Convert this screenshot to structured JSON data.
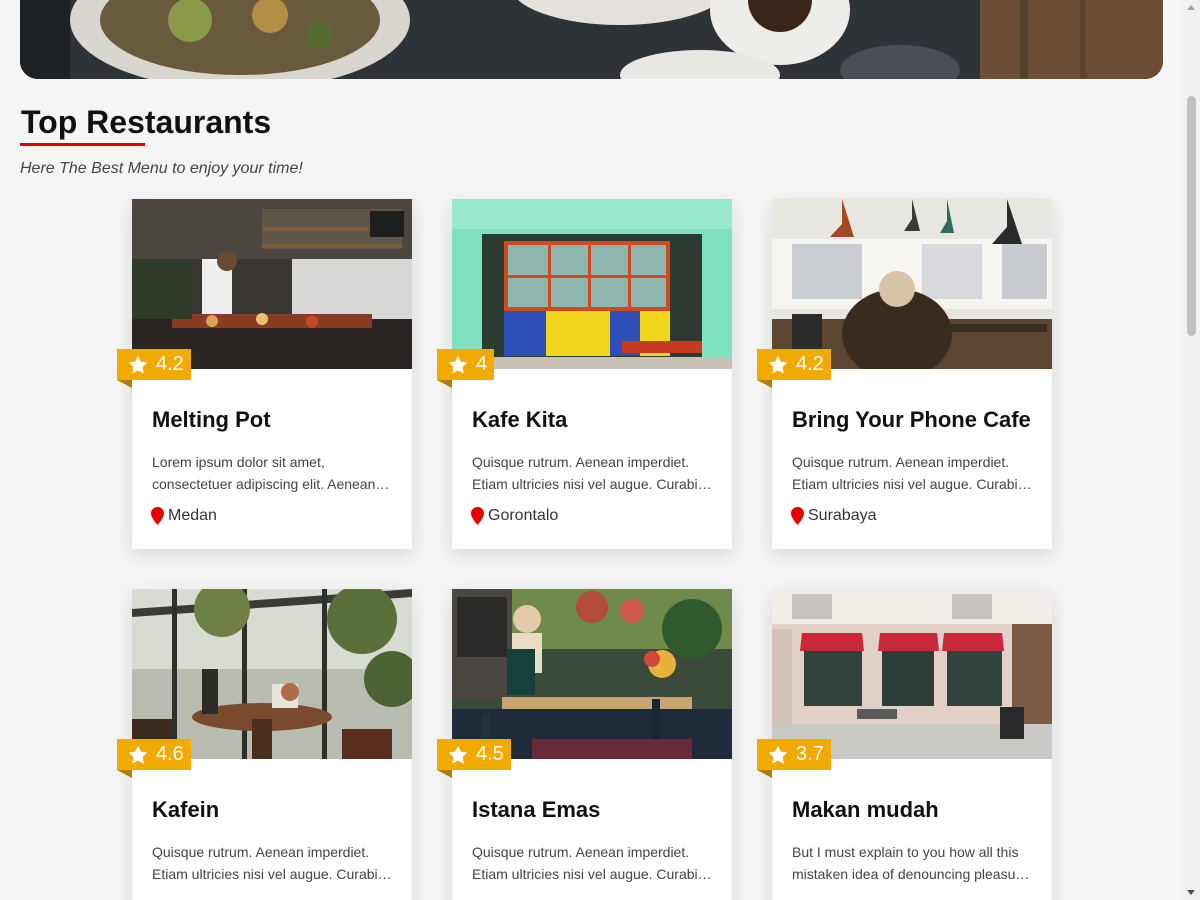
{
  "section": {
    "title": "Top Restaurants",
    "subtitle": "Here The Best Menu to enjoy your time!"
  },
  "colors": {
    "accent_red": "#e60000",
    "rating_badge": "#f2a900",
    "pin": "#e60000"
  },
  "restaurants": [
    {
      "name": "Melting Pot",
      "rating": "4.2",
      "desc_line1": "Lorem ipsum dolor sit amet,",
      "desc_line2": "consectetuer adipiscing elit. Aenean commodo",
      "city": "Medan",
      "image": "cafe-kitchen-counter"
    },
    {
      "name": "Kafe Kita",
      "rating": "4",
      "desc_line1": "Quisque rutrum. Aenean imperdiet.",
      "desc_line2": "Etiam ultricies nisi vel augue. Curabitur",
      "city": "Gorontalo",
      "image": "colorful-shopfront"
    },
    {
      "name": "Bring Your Phone Cafe",
      "rating": "4.2",
      "desc_line1": "Quisque rutrum. Aenean imperdiet.",
      "desc_line2": "Etiam ultricies nisi vel augue. Curabitur",
      "city": "Surabaya",
      "image": "man-in-cafe"
    },
    {
      "name": "Kafein",
      "rating": "4.6",
      "desc_line1": "Quisque rutrum. Aenean imperdiet.",
      "desc_line2": "Etiam ultricies nisi vel augue. Curabitur",
      "city": "",
      "image": "greenhouse-table"
    },
    {
      "name": "Istana Emas",
      "rating": "4.5",
      "desc_line1": "Quisque rutrum. Aenean imperdiet.",
      "desc_line2": "Etiam ultricies nisi vel augue. Curabitur",
      "city": "",
      "image": "garden-patio"
    },
    {
      "name": "Makan mudah",
      "rating": "3.7",
      "desc_line1": "But I must explain to you how all this",
      "desc_line2": "mistaken idea of denouncing pleasure and",
      "city": "",
      "image": "street-storefront"
    }
  ]
}
